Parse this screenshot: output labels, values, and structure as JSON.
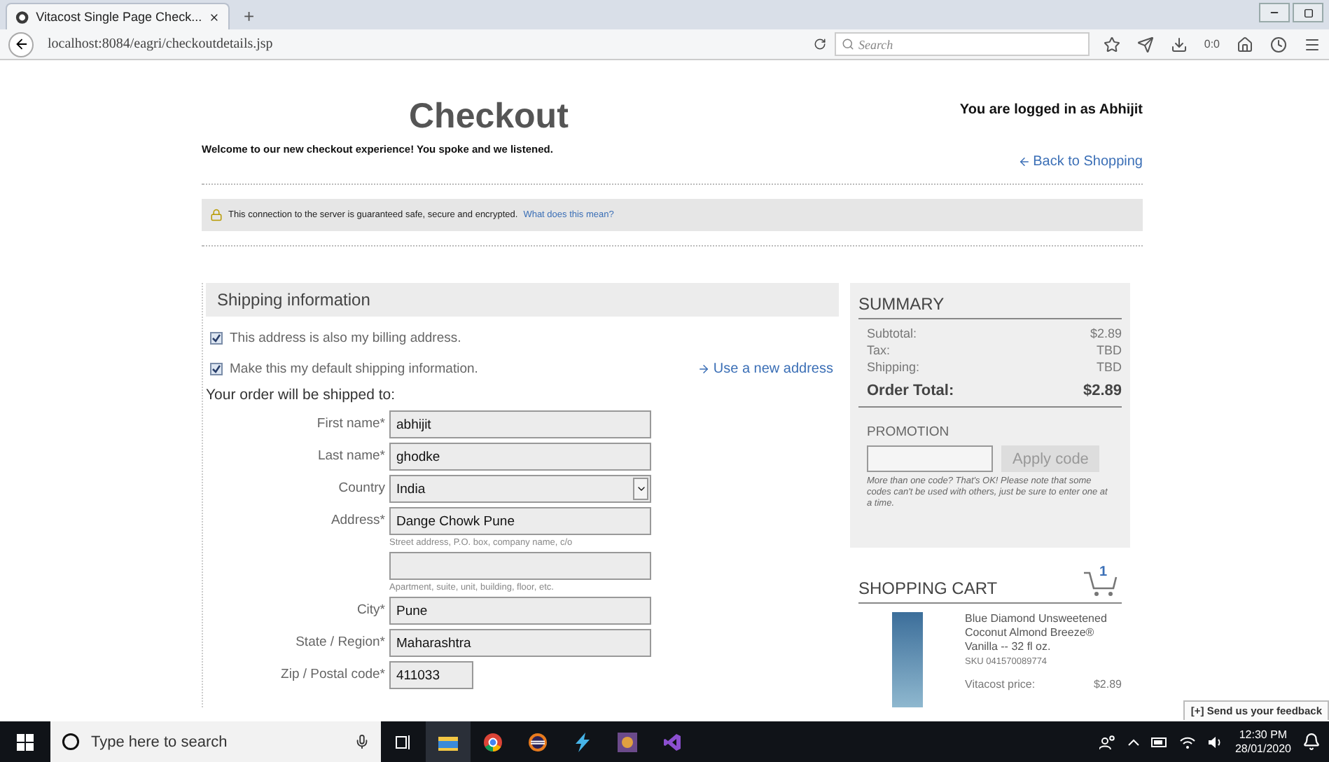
{
  "browser": {
    "tabs": [
      {
        "title": "Vitacost Single Page Check...",
        "selected": true
      }
    ],
    "new_tab": "+",
    "url": "localhost:8084/eagri/checkoutdetails.jsp",
    "search_placeholder": "Search",
    "download_count": "0:0"
  },
  "page": {
    "title": "Checkout",
    "login_text": "You are logged in as Abhijit",
    "welcome": "Welcome to our new checkout experience! You spoke and we listened.",
    "back_link": "Back to Shopping",
    "security": {
      "text": "This connection to the server is guaranteed safe, secure and encrypted.",
      "link": "What does this mean?"
    },
    "shipping": {
      "heading": "Shipping information",
      "options": [
        {
          "label": "This address is also my billing address.",
          "checked": true
        },
        {
          "label": "Make this my default shipping information.",
          "checked": true
        }
      ],
      "new_address_link": "Use a new address",
      "ship_to": "Your order will be shipped to:",
      "fields": [
        {
          "kind": "text",
          "label": "First name*",
          "value": "abhijit"
        },
        {
          "kind": "text",
          "label": "Last name*",
          "value": "ghodke"
        },
        {
          "kind": "select",
          "label": "Country",
          "value": "India"
        },
        {
          "kind": "text",
          "label": "Address*",
          "value": "Dange Chowk Pune",
          "hint": "Street address, P.O. box, company name, c/o"
        },
        {
          "kind": "text",
          "hint": "Apartment, suite, unit, building, floor, etc."
        },
        {
          "kind": "text",
          "label": "City*",
          "value": "Pune"
        },
        {
          "kind": "text",
          "label": "State / Region*",
          "value": "Maharashtra"
        },
        {
          "kind": "short",
          "label": "Zip / Postal code*",
          "value": "411033"
        }
      ]
    },
    "summary": {
      "heading": "SUMMARY",
      "rows": [
        {
          "label": "Subtotal:",
          "value": "$2.89"
        },
        {
          "label": "Tax:",
          "value": "TBD"
        },
        {
          "label": "Shipping:",
          "value": "TBD"
        }
      ],
      "total": {
        "label": "Order Total:",
        "value": "$2.89"
      },
      "promotion": {
        "heading": "PROMOTION",
        "button": "Apply code",
        "note": "More than one code? That's OK! Please note that some codes can't be used with others, just be sure to enter one at a time."
      }
    },
    "cart": {
      "heading": "SHOPPING CART",
      "count": "1",
      "items": [
        {
          "name": "Blue Diamond Unsweetened Coconut Almond Breeze® Vanilla -- 32 fl oz.",
          "sku": "SKU 041570089774",
          "price_label": "Vitacost price:",
          "price": "$2.89"
        }
      ]
    },
    "feedback": "[+] Send us your feedback"
  },
  "taskbar": {
    "search_placeholder": "Type here to search",
    "time": "12:30 PM",
    "date": "28/01/2020"
  }
}
